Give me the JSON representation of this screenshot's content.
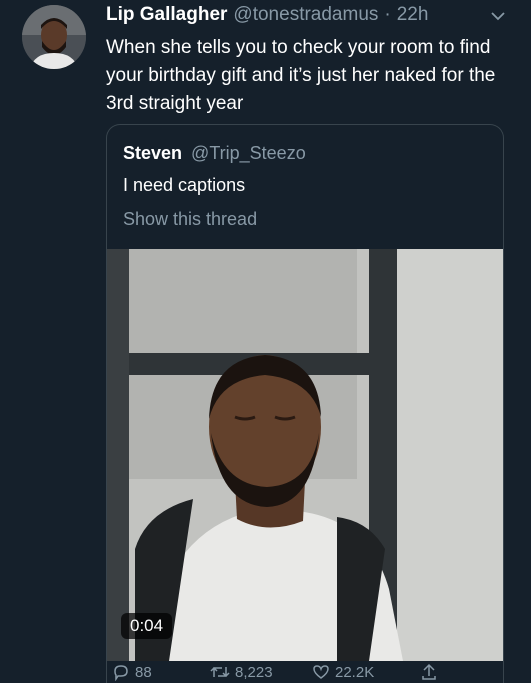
{
  "tweet": {
    "display_name": "Lip Gallagher",
    "handle": "@tonestradamus",
    "separator": "·",
    "time": "22h",
    "text": "When she tells you to check your room to find your birthday gift and it’s just her naked for the 3rd straight year",
    "avatar_icon": "user-avatar",
    "more_icon": "chevron-down-icon"
  },
  "quoted": {
    "display_name": "Steven",
    "handle": "@Trip_Steezo",
    "text": "I need captions",
    "show_thread": "Show this thread",
    "video_duration": "0:04"
  },
  "actions": {
    "reply_count": "88",
    "retweet_count": "8,223",
    "like_count": "22.2K",
    "reply_icon": "reply-icon",
    "retweet_icon": "retweet-icon",
    "like_icon": "heart-icon",
    "share_icon": "share-icon"
  },
  "colors": {
    "background": "#15202b",
    "secondary_text": "#8899a6",
    "border": "#38444d"
  }
}
